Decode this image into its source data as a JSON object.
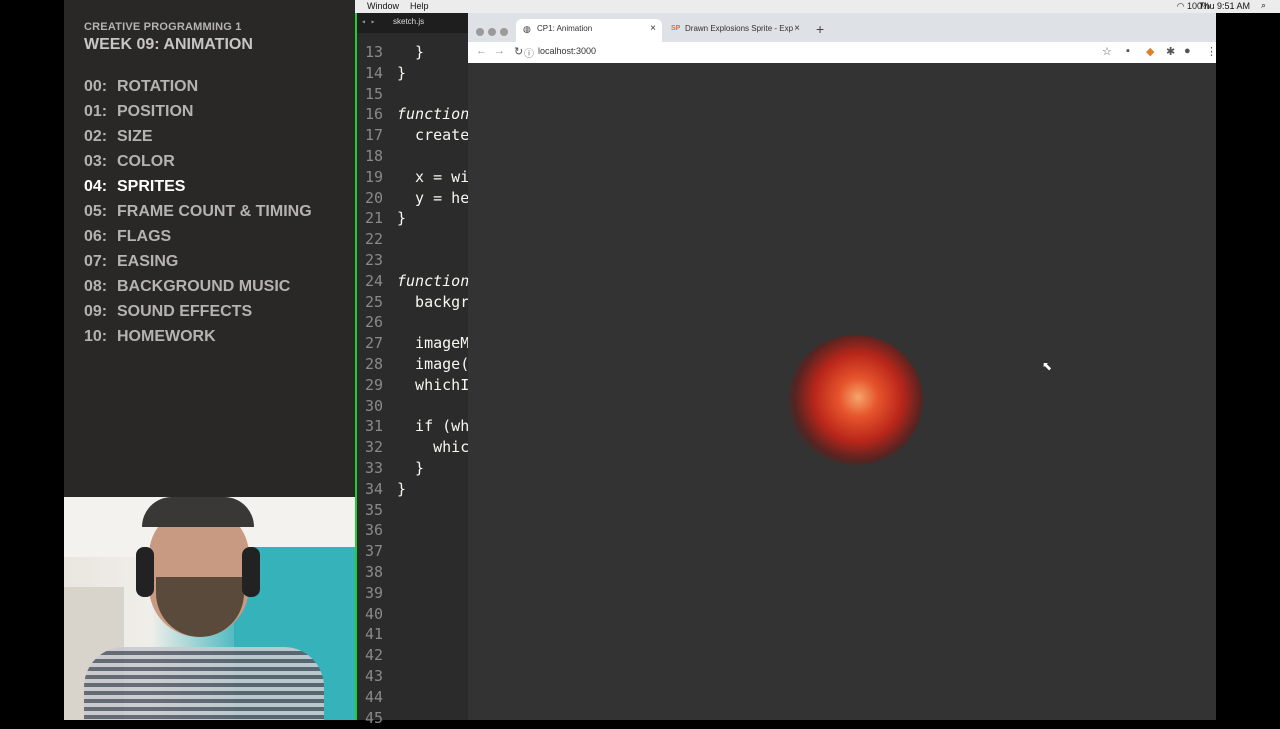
{
  "course": {
    "title": "CREATIVE PROGRAMMING 1",
    "week": "WEEK 09: ANIMATION",
    "topics": [
      {
        "num": "00:",
        "label": "ROTATION"
      },
      {
        "num": "01:",
        "label": "POSITION"
      },
      {
        "num": "02:",
        "label": "SIZE"
      },
      {
        "num": "03:",
        "label": "COLOR"
      },
      {
        "num": "04:",
        "label": "SPRITES"
      },
      {
        "num": "05:",
        "label": "FRAME COUNT & TIMING"
      },
      {
        "num": "06:",
        "label": "FLAGS"
      },
      {
        "num": "07:",
        "label": "EASING"
      },
      {
        "num": "08:",
        "label": "BACKGROUND MUSIC"
      },
      {
        "num": "09:",
        "label": "SOUND EFFECTS"
      },
      {
        "num": "10:",
        "label": "HOMEWORK"
      }
    ],
    "active_index": 4
  },
  "menubar": {
    "items": [
      "Window",
      "Help"
    ],
    "battery": "100%",
    "clock": "Thu 9:51 AM"
  },
  "editor": {
    "filename": "sketch.js",
    "lines": [
      {
        "n": "13",
        "code": "  }"
      },
      {
        "n": "14",
        "code": "}"
      },
      {
        "n": "15",
        "code": ""
      },
      {
        "n": "16",
        "code": "function"
      },
      {
        "n": "17",
        "code": "  create"
      },
      {
        "n": "18",
        "code": ""
      },
      {
        "n": "19",
        "code": "  x = wi"
      },
      {
        "n": "20",
        "code": "  y = he"
      },
      {
        "n": "21",
        "code": "}"
      },
      {
        "n": "22",
        "code": ""
      },
      {
        "n": "23",
        "code": ""
      },
      {
        "n": "24",
        "code": "function"
      },
      {
        "n": "25",
        "code": "  backgr"
      },
      {
        "n": "26",
        "code": ""
      },
      {
        "n": "27",
        "code": "  imageM"
      },
      {
        "n": "28",
        "code": "  image("
      },
      {
        "n": "29",
        "code": "  whichI"
      },
      {
        "n": "30",
        "code": ""
      },
      {
        "n": "31",
        "code": "  if (wh"
      },
      {
        "n": "32",
        "code": "    whic"
      },
      {
        "n": "33",
        "code": "  }"
      },
      {
        "n": "34",
        "code": "}"
      },
      {
        "n": "35",
        "code": ""
      },
      {
        "n": "36",
        "code": ""
      },
      {
        "n": "37",
        "code": ""
      },
      {
        "n": "38",
        "code": ""
      },
      {
        "n": "39",
        "code": ""
      },
      {
        "n": "40",
        "code": ""
      },
      {
        "n": "41",
        "code": ""
      },
      {
        "n": "42",
        "code": ""
      },
      {
        "n": "43",
        "code": ""
      },
      {
        "n": "44",
        "code": ""
      },
      {
        "n": "45",
        "code": ""
      }
    ],
    "highlight_line": "32"
  },
  "browser": {
    "tabs": [
      {
        "label": "CP1: Animation",
        "favicon": "globe-icon",
        "active": true
      },
      {
        "label": "Drawn Explosions Sprite - Expl",
        "favicon": "SP",
        "active": false
      }
    ],
    "url": "localhost:3000",
    "canvas_color": "#333333"
  }
}
